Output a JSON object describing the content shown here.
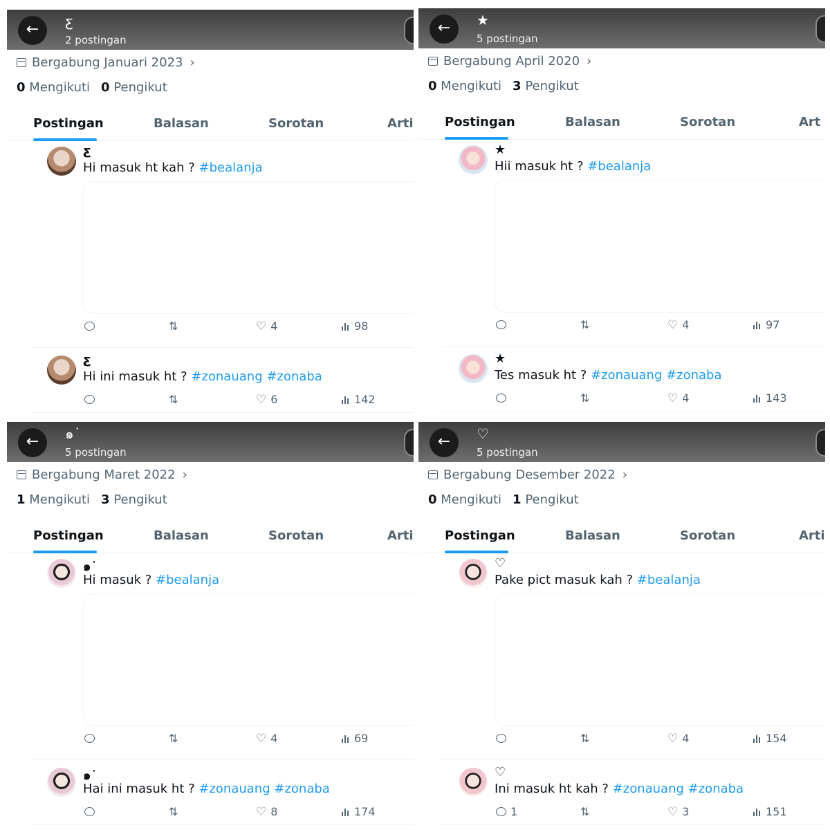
{
  "tabs": [
    "Postingan",
    "Balasan",
    "Sorotan",
    "Arti"
  ],
  "panels": [
    {
      "name": "ƹ",
      "posts": "2 postingan",
      "joined": "Bergabung Januari 2023",
      "following": "0",
      "following_label": "Mengikuti",
      "followers": "0",
      "followers_label": "Pengikut",
      "tabs": [
        "Postingan",
        "Balasan",
        "Sorotan",
        "Arti"
      ],
      "tweets": [
        {
          "name": "ƹ",
          "text": "Hi masuk ht kah ? ",
          "tags": "#bealanja",
          "reply": "",
          "retweet": "",
          "like": "4",
          "views": "98"
        },
        {
          "name": "ƹ",
          "text": "Hi ini masuk ht ? ",
          "tags": "#zonauang #zonaba",
          "reply": "",
          "retweet": "",
          "like": "6",
          "views": "142"
        }
      ]
    },
    {
      "name": "★",
      "posts": "5 postingan",
      "joined": "Bergabung April 2020",
      "following": "0",
      "following_label": "Mengikuti",
      "followers": "3",
      "followers_label": "Pengikut",
      "tabs": [
        "Postingan",
        "Balasan",
        "Sorotan",
        "Art"
      ],
      "tweets": [
        {
          "name": "★",
          "text": "Hii masuk ht ? ",
          "tags": "#bealanja",
          "reply": "",
          "retweet": "",
          "like": "4",
          "views": "97"
        },
        {
          "name": "★",
          "text": "Tes masuk ht ? ",
          "tags": "#zonauang #zonaba",
          "reply": "",
          "retweet": "",
          "like": "4",
          "views": "143"
        }
      ]
    },
    {
      "name": "๑˙",
      "posts": "5 postingan",
      "joined": "Bergabung Maret 2022",
      "following": "1",
      "following_label": "Mengikuti",
      "followers": "3",
      "followers_label": "Pengikut",
      "tabs": [
        "Postingan",
        "Balasan",
        "Sorotan",
        "Arti"
      ],
      "tweets": [
        {
          "name": "๑˙",
          "text": "Hi masuk ? ",
          "tags": "#bealanja",
          "reply": "",
          "retweet": "",
          "like": "4",
          "views": "69"
        },
        {
          "name": "๑˙",
          "text": "Hai ini masuk ht ? ",
          "tags": "#zonauang #zonaba",
          "reply": "",
          "retweet": "",
          "like": "8",
          "views": "174"
        }
      ]
    },
    {
      "name": "♡",
      "posts": "5 postingan",
      "joined": "Bergabung Desember 2022",
      "following": "0",
      "following_label": "Mengikuti",
      "followers": "1",
      "followers_label": "Pengikut",
      "tabs": [
        "Postingan",
        "Balasan",
        "Sorotan",
        "Artil"
      ],
      "tweets": [
        {
          "name": "♡",
          "text": "Pake pict masuk kah ? ",
          "tags": "#bealanja",
          "reply": "",
          "retweet": "",
          "like": "4",
          "views": "154"
        },
        {
          "name": "♡",
          "text": "Ini masuk ht kah ? ",
          "tags": "#zonauang #zonaba",
          "reply": "1",
          "retweet": "",
          "like": "3",
          "views": "151"
        }
      ]
    }
  ],
  "colors": {
    "accent": "#1d9bf0",
    "muted": "#536471",
    "text": "#0f1419",
    "header": "#4a4a4a"
  },
  "icons": {
    "back": "arrow-left-icon",
    "calendar": "calendar-icon",
    "reply": "reply-icon",
    "retweet": "retweet-icon",
    "like": "heart-icon",
    "views": "views-icon"
  }
}
